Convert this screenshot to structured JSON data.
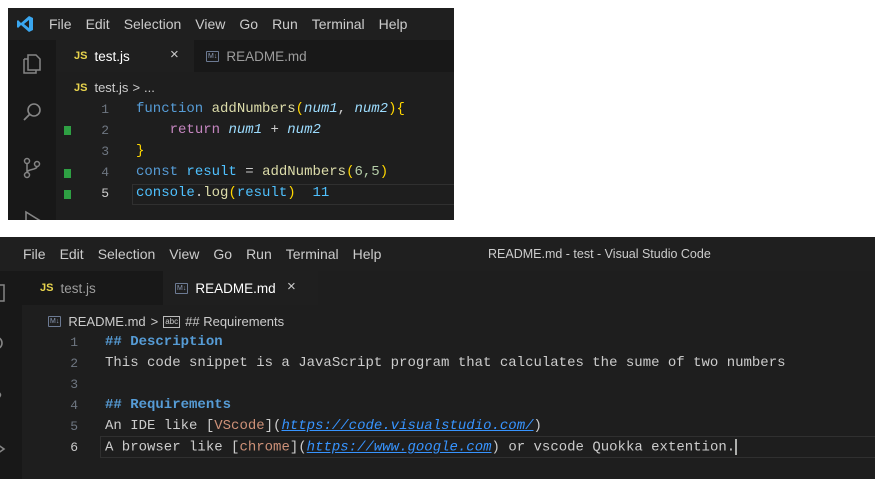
{
  "window1": {
    "menu": [
      "File",
      "Edit",
      "Selection",
      "View",
      "Go",
      "Run",
      "Terminal",
      "Help"
    ],
    "tabs": [
      {
        "badge": "JS",
        "label": "test.js",
        "close": "×"
      },
      {
        "badge": "M↓",
        "label": "README.md"
      }
    ],
    "breadcrumb": {
      "badge": "JS",
      "file": "test.js",
      "sep": ">",
      "rest": "..."
    },
    "line_numbers": [
      "1",
      "2",
      "3",
      "4",
      "5"
    ],
    "code": {
      "l1": {
        "kw": "function",
        "fn": "addNumbers",
        "p1": "num1",
        "comma": ", ",
        "p2": "num2"
      },
      "l2": {
        "kw": "return",
        "v1": "num1",
        "op": " + ",
        "v2": "num2"
      },
      "l3": {
        "brace": "}"
      },
      "l4": {
        "kw": "const",
        "var": "result",
        "op": " = ",
        "fn": "addNumbers",
        "args": "6,5"
      },
      "l5": {
        "obj": "console",
        "dot": ".",
        "fn": "log",
        "arg": "result",
        "output": "11"
      }
    },
    "git_markers": [
      "added",
      "added",
      "added"
    ]
  },
  "window2": {
    "menu": [
      "File",
      "Edit",
      "Selection",
      "View",
      "Go",
      "Run",
      "Terminal",
      "Help"
    ],
    "title": "README.md - test - Visual Studio Code",
    "tabs": [
      {
        "badge": "JS",
        "label": "test.js"
      },
      {
        "badge": "M↓",
        "label": "README.md",
        "close": "×"
      }
    ],
    "breadcrumb": {
      "badge": "M↓",
      "file": "README.md",
      "sep": ">",
      "symbol_badge": "abc",
      "symbol": "## Requirements"
    },
    "line_numbers": [
      "1",
      "2",
      "3",
      "4",
      "5",
      "6"
    ],
    "lines": {
      "l1": "## Description",
      "l2": "This code snippet is a JavaScript program that calculates the sume of two numbers",
      "l4": "## Requirements",
      "l5": {
        "pre": "An IDE like ",
        "lb": "[",
        "link": "VScode",
        "rb": "](",
        "url": "https://code.visualstudio.com/",
        "end": ")"
      },
      "l6": {
        "pre": "A browser like ",
        "lb": "[",
        "link": "chrome",
        "rb": "](",
        "url": "https://www.google.com",
        "mid": ") or vscode Quokka extention."
      }
    }
  },
  "colors": {
    "editor_bg": "#1e1e1e",
    "accent_vscode": "#3aa7f0",
    "git_added": "#2ea043"
  }
}
